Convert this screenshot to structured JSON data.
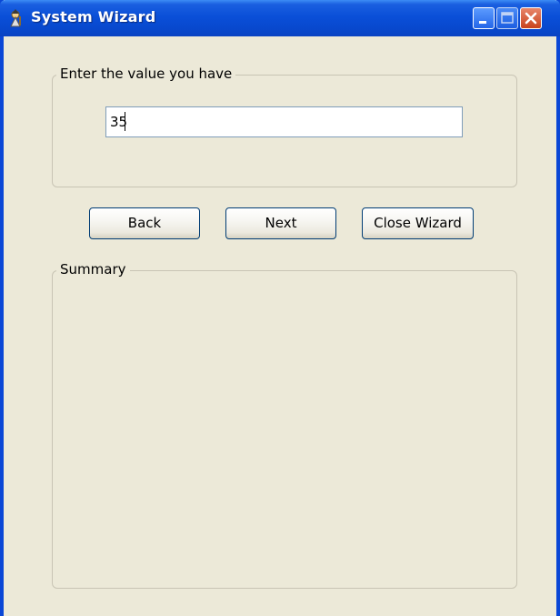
{
  "window": {
    "title": "System Wizard",
    "icon": "wizard-app-icon"
  },
  "titlebar_buttons": {
    "minimize": "minimize-icon",
    "maximize": "maximize-icon",
    "close": "close-icon"
  },
  "value_group": {
    "legend": "Enter the value you have",
    "input_value": "35"
  },
  "buttons": {
    "back": "Back",
    "next": "Next",
    "close_wizard": "Close Wizard"
  },
  "summary_group": {
    "legend": "Summary",
    "content": ""
  },
  "colors": {
    "titlebar": "#0a4fd8",
    "window_bg": "#ece9d8",
    "close_button": "#c8431d",
    "button_border": "#003c74"
  }
}
